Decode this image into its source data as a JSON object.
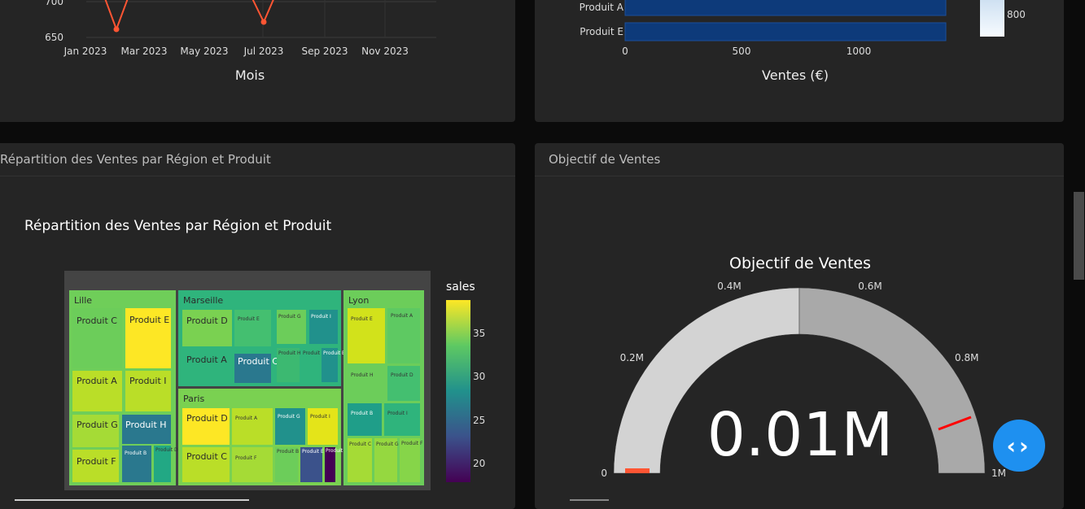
{
  "line_chart": {
    "chart_data": {
      "type": "line",
      "x": [
        "Jan 2023",
        "Feb 2023",
        "Mar 2023",
        "Jul 2023",
        "Aug 2023"
      ],
      "y_ticks": [
        "650",
        "700"
      ],
      "x_ticks": [
        "Jan 2023",
        "Mar 2023",
        "May 2023",
        "Jul 2023",
        "Sep 2023",
        "Nov 2023"
      ],
      "xlabel": "Mois",
      "color": "#ff5533"
    }
  },
  "bar_chart": {
    "chart_data": {
      "type": "bar",
      "orientation": "horizontal",
      "categories": [
        "Produit A",
        "Produit E"
      ],
      "values": [
        1400,
        1400
      ],
      "x_ticks": [
        "0",
        "500",
        "1000"
      ],
      "xlabel": "Ventes (€)",
      "color": "#0d3a7a",
      "colorbar_label": "800"
    }
  },
  "treemap_card": {
    "header": "Répartition des Ventes par Région et Produit",
    "chart_data": {
      "type": "heatmap",
      "subtype": "treemap",
      "title": "Répartition des Ventes par Région et Produit",
      "colorbar_title": "sales",
      "colorbar_ticks": [
        "35",
        "30",
        "25",
        "20"
      ],
      "regions": [
        {
          "name": "Lille",
          "products": [
            "Produit C",
            "Produit E",
            "Produit A",
            "Produit I",
            "Produit G",
            "Produit H",
            "Produit F",
            "Produit B",
            "Produit D"
          ]
        },
        {
          "name": "Marseille",
          "products": [
            "Produit D",
            "Produit E",
            "Produit G",
            "Produit I",
            "Produit A",
            "Produit C",
            "Produit H",
            "Produit F",
            "Produit B"
          ]
        },
        {
          "name": "Paris",
          "products": [
            "Produit D",
            "Produit A",
            "Produit G",
            "Produit I",
            "Produit C",
            "Produit F",
            "Produit B",
            "Produit E",
            "Produit H"
          ]
        },
        {
          "name": "Lyon",
          "products": [
            "Produit E",
            "Produit A",
            "Produit H",
            "Produit D",
            "Produit B",
            "Produit I",
            "Produit C",
            "Produit G",
            "Produit F"
          ]
        }
      ]
    }
  },
  "gauge_card": {
    "header": "Objectif de Ventes",
    "chart_data": {
      "type": "gauge",
      "title": "Objectif de Ventes",
      "value": 0.01,
      "value_text": "0.01M",
      "range": [
        0,
        1
      ],
      "ticks": [
        "0",
        "0.2M",
        "0.4M",
        "0.6M",
        "0.8M",
        "1M"
      ],
      "threshold": 0.9,
      "colors": {
        "band_light": "#d3d3d3",
        "band_dark": "#a9a9a9",
        "bar": "#ff5533",
        "threshold": "#ff0000"
      }
    }
  },
  "icons": {
    "fab": "code-brackets-icon"
  },
  "fab_label": "‹›"
}
